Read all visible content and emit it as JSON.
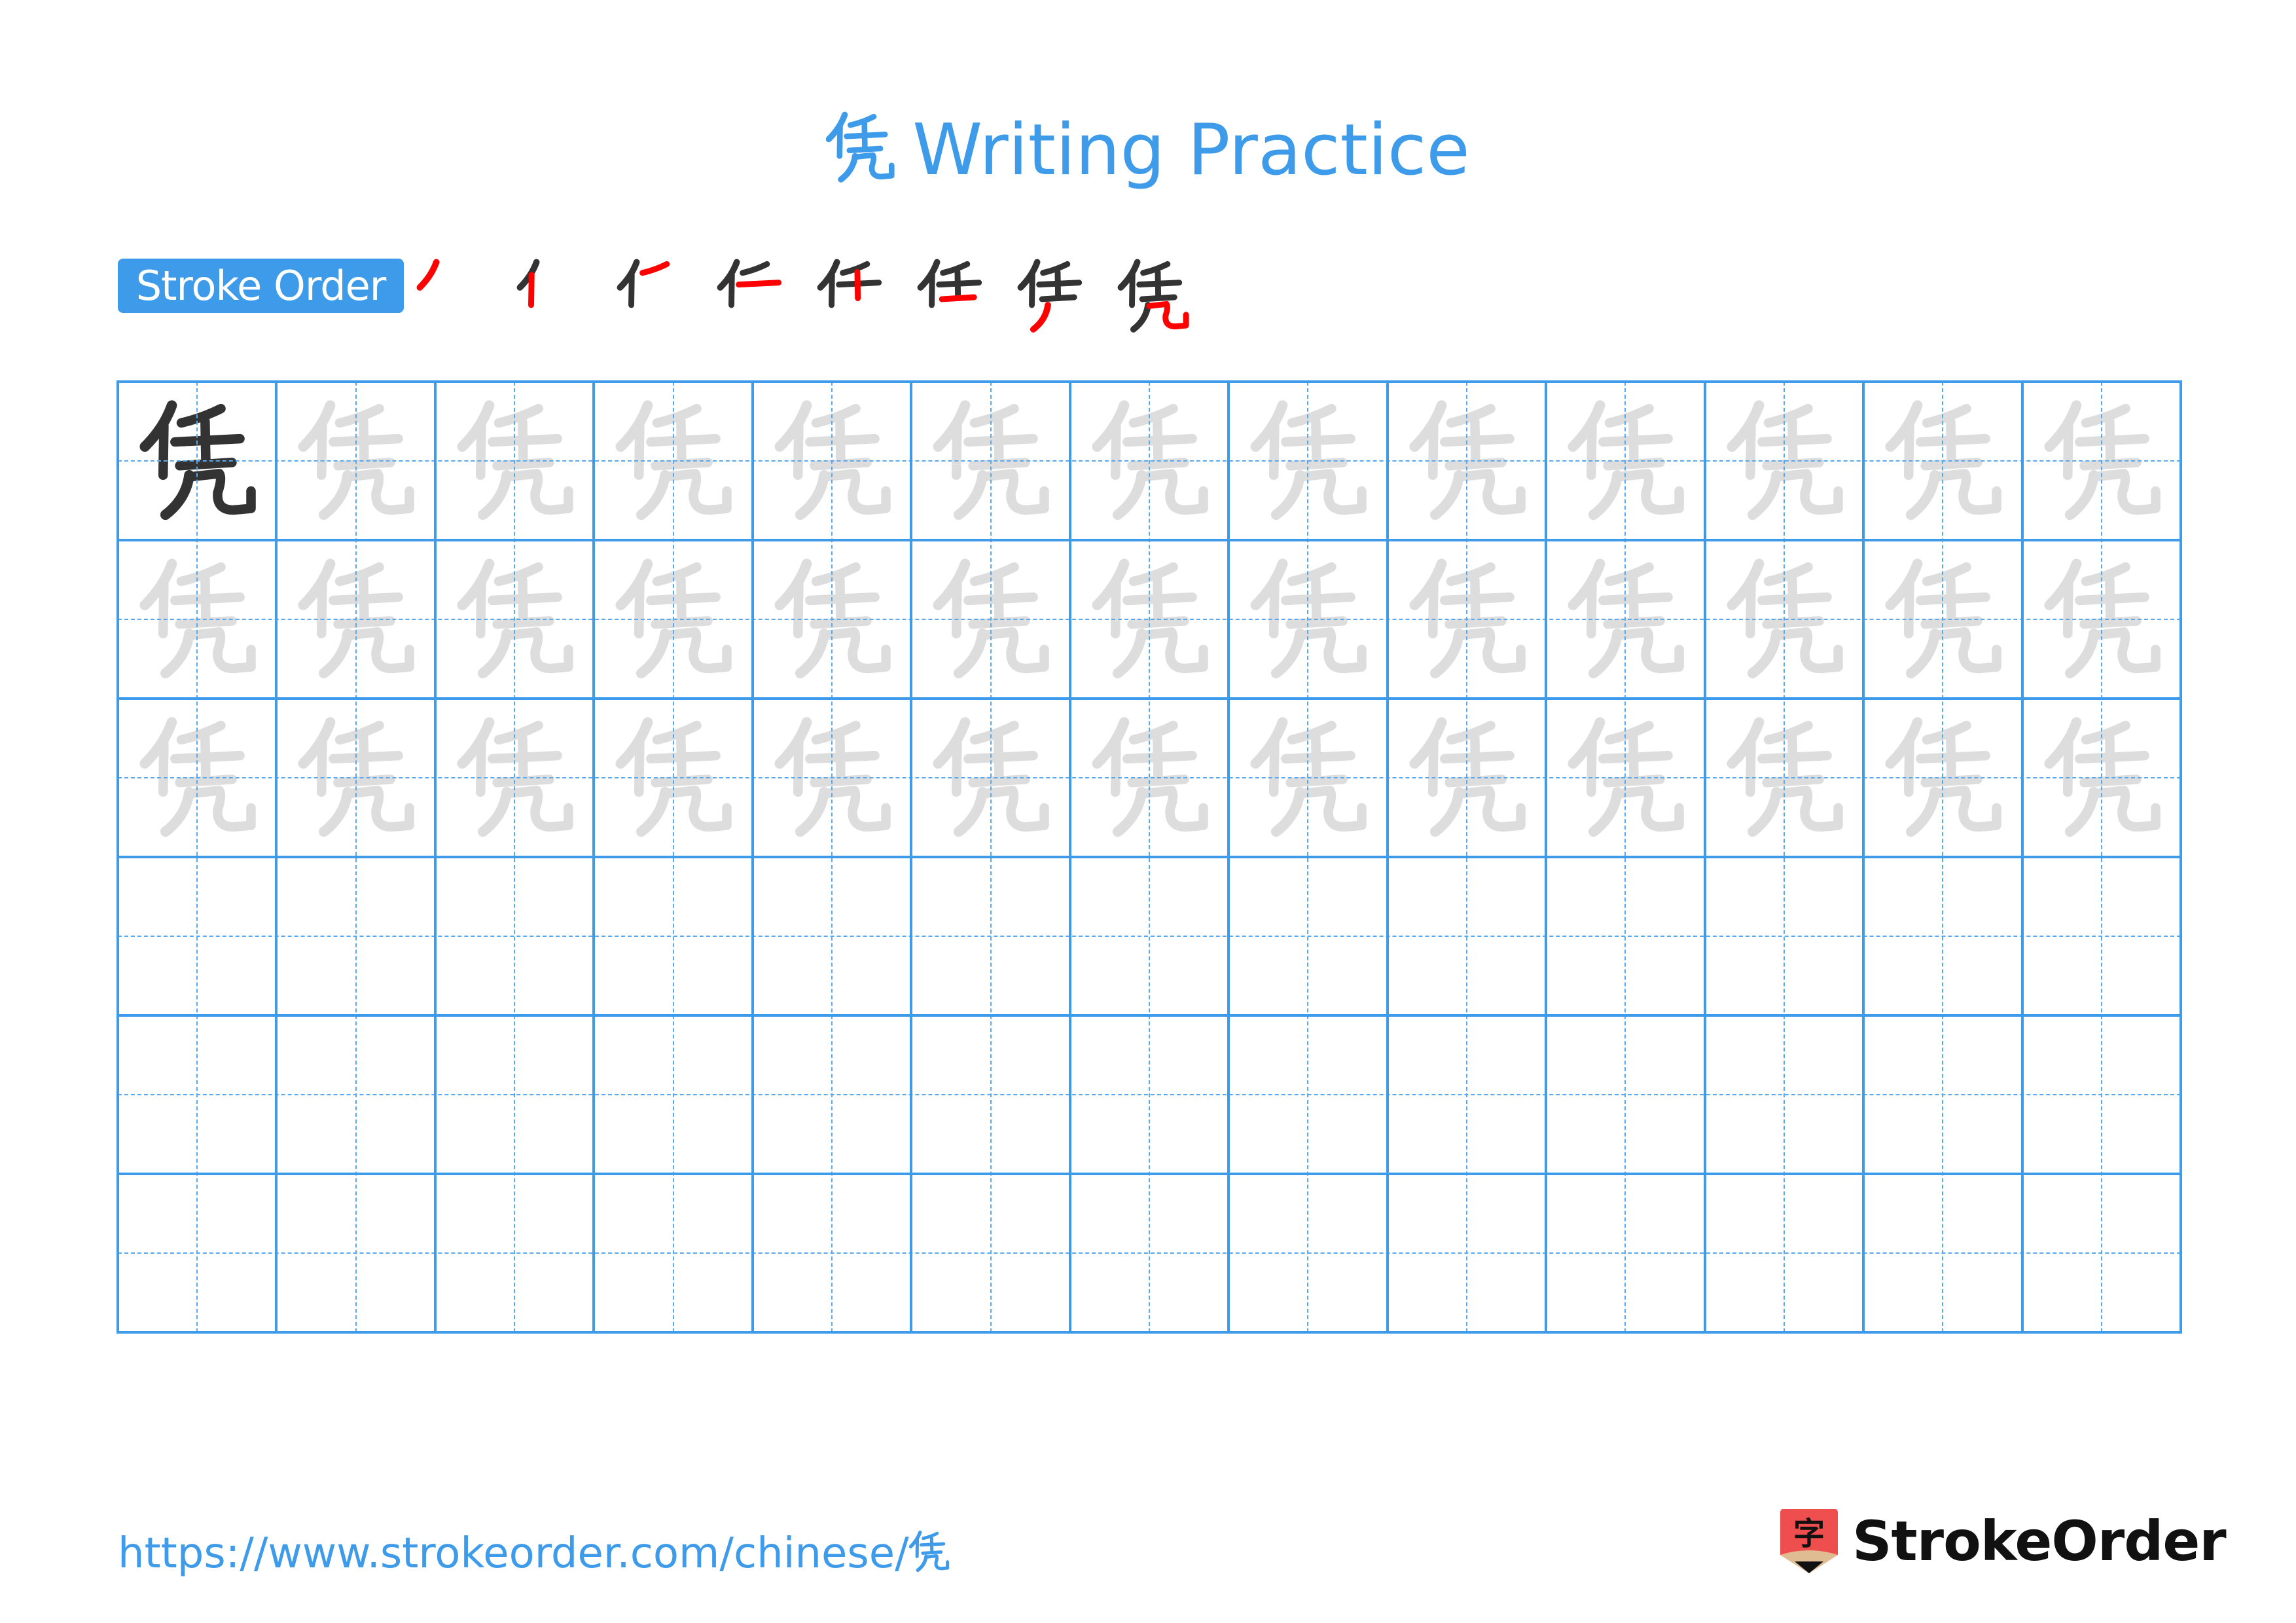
{
  "page": {
    "character": "凭",
    "title_suffix": "Writing Practice",
    "title": "凭 Writing Practice"
  },
  "stroke_order": {
    "label": "Stroke Order",
    "stroke_count": 8,
    "steps": [
      1,
      2,
      3,
      4,
      5,
      6,
      7,
      8
    ],
    "highlight_color": "#ff0000",
    "drawn_color": "#333333"
  },
  "practice_grid": {
    "rows": 6,
    "columns": 13,
    "model_cells": 1,
    "trace_rows": 3,
    "blank_rows": 3,
    "line_color": "#3d9be9",
    "model_color": "#333333",
    "trace_color": "#dddddd"
  },
  "footer": {
    "url": "https://www.strokeorder.com/chinese/",
    "url_character": "凭",
    "brand": "StrokeOrder",
    "logo_glyph": "字",
    "logo_color": "#ef4e4e"
  }
}
